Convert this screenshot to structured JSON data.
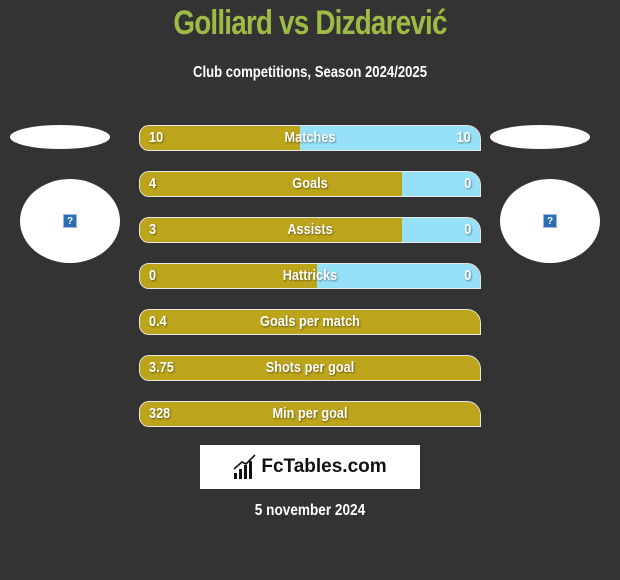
{
  "header": {
    "title": "Golliard vs Dizdarević",
    "subtitle": "Club competitions, Season 2024/2025"
  },
  "players": {
    "left": {
      "name": "Golliard",
      "avatar_icon": "?"
    },
    "right": {
      "name": "Dizdarević",
      "avatar_icon": "?"
    }
  },
  "colors": {
    "title": "#9dbb45",
    "left_bar": "#bca51a",
    "right_bar": "#97e1f8",
    "background": "#333333"
  },
  "stats": [
    {
      "label": "Matches",
      "left": "10",
      "right": "10",
      "left_share": 0.47
    },
    {
      "label": "Goals",
      "left": "4",
      "right": "0",
      "left_share": 0.77
    },
    {
      "label": "Assists",
      "left": "3",
      "right": "0",
      "left_share": 0.77
    },
    {
      "label": "Hattricks",
      "left": "0",
      "right": "0",
      "left_share": 0.52
    },
    {
      "label": "Goals per match",
      "left": "0.4",
      "right": "",
      "left_share": 1.0
    },
    {
      "label": "Shots per goal",
      "left": "3.75",
      "right": "",
      "left_share": 1.0
    },
    {
      "label": "Min per goal",
      "left": "328",
      "right": "",
      "left_share": 1.0
    }
  ],
  "footer": {
    "logo_text": "FcTables.com",
    "date": "5 november 2024"
  }
}
